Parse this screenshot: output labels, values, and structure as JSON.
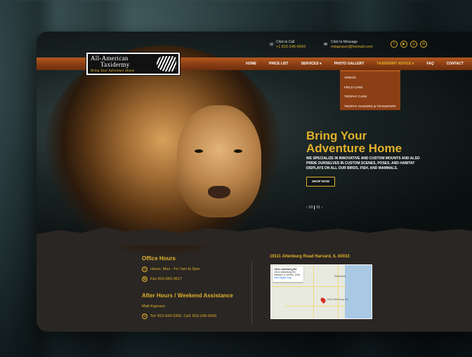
{
  "header": {
    "call_label": "Click to Call",
    "call_value": "+1 815-245-6043",
    "message_label": "Click to Message",
    "message_value": "mkapraun@hotmail.com",
    "socials": [
      "facebook-icon",
      "youtube-icon",
      "instagram-icon",
      "email-icon"
    ]
  },
  "logo": {
    "line1": "All-American",
    "line2": "Taxidermy",
    "tagline": "Bring Your Adventure Home"
  },
  "nav": {
    "items": [
      "HOME",
      "PRICE LIST",
      "SERVICES",
      "PHOTO GALLERY",
      "TAXIDERMY ADVICE",
      "FAQ",
      "CONTACT"
    ],
    "active": "TAXIDERMY ADVICE"
  },
  "dropdown": {
    "items": [
      "VIDEOS",
      "FIELD CARE",
      "TROPHY CARE",
      "TROPHY HANGING & TRANSPORT"
    ]
  },
  "hero": {
    "headline_line1": "Bring Your",
    "headline_line2": "Adventure Home",
    "subtext": "WE SPECIALIZE IN INNOVATIVE AND CUSTOM MOUNTS AND ALSO PRIDE OURSELVES IN CUSTOM SCENES, POSES, AND HABITAT DISPLAYS ON ALL OUR BIRDS, FISH, AND MAMMALS.",
    "cta": "SHOP NOW",
    "slide_current": "03",
    "slide_total": "01"
  },
  "office": {
    "title": "Office Hours",
    "hours": "Hours: Mon - Fri 7am to 5pm",
    "fax": "Fax 815-943-3617",
    "after_title": "After Hours / Weekend Assistance",
    "contact_name": "Matt Kapraun",
    "tel": "Tel: 815-943-0300, Cell: 815-245-6043"
  },
  "location": {
    "address": "19111 Altenburg Road Harvard, IL 60033",
    "map_card_title": "19111 Altenburg Rd",
    "map_card_sub": "19111 Altenburg Rd, Harvard, IL 60033, USA",
    "map_card_link": "View larger map",
    "map_label_city": "Milwaukee",
    "map_label_pin": "19111 Altenburg Rd"
  },
  "colors": {
    "accent": "#e0b12a",
    "nav_bar": "#8c3f14",
    "footer_bg": "#2a2623"
  }
}
